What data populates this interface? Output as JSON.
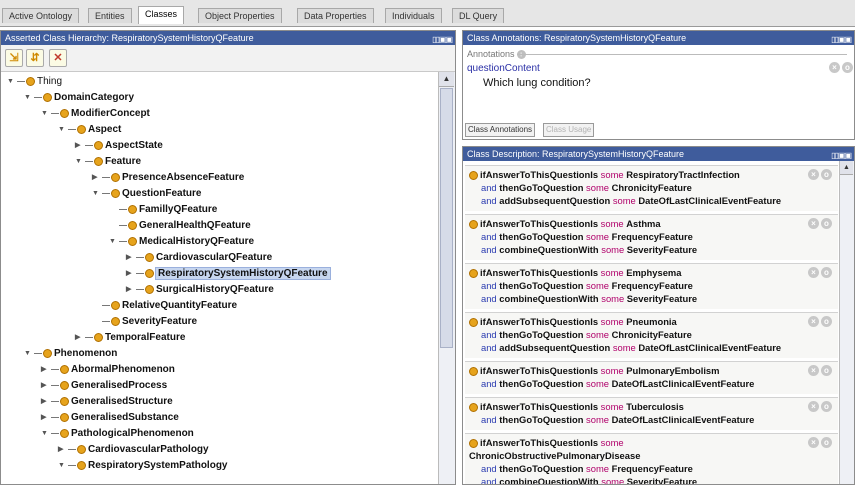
{
  "tabs": [
    "Active Ontology",
    "Entities",
    "Classes",
    "Object Properties",
    "Data Properties",
    "Individuals",
    "DL Query"
  ],
  "active_tab_index": 2,
  "left_panel": {
    "title": "Asserted Class Hierarchy: RespiratorySystemHistoryQFeature",
    "window_controls": "▯▯▣▣",
    "toolbar_icons": [
      "add-subclass-icon",
      "add-sibling-icon",
      "delete-class-icon"
    ],
    "tree": [
      {
        "label": "Thing",
        "state": "open"
      },
      {
        "label": "DomainCategory",
        "state": "open"
      },
      {
        "label": "ModifierConcept",
        "state": "open"
      },
      {
        "label": "Aspect",
        "state": "open"
      },
      {
        "label": "AspectState",
        "state": "closed"
      },
      {
        "label": "Feature",
        "state": "open"
      },
      {
        "label": "PresenceAbsenceFeature",
        "state": "closed"
      },
      {
        "label": "QuestionFeature",
        "state": "open"
      },
      {
        "label": "FamillyQFeature",
        "state": "leaf"
      },
      {
        "label": "GeneralHealthQFeature",
        "state": "leaf"
      },
      {
        "label": "MedicalHistoryQFeature",
        "state": "open"
      },
      {
        "label": "CardiovascularQFeature",
        "state": "closed"
      },
      {
        "label": "RespiratorySystemHistoryQFeature",
        "state": "closed",
        "selected": true
      },
      {
        "label": "SurgicalHistoryQFeature",
        "state": "closed"
      },
      {
        "label": "RelativeQuantityFeature",
        "state": "leaf"
      },
      {
        "label": "SeverityFeature",
        "state": "leaf"
      },
      {
        "label": "TemporalFeature",
        "state": "closed"
      },
      {
        "label": "Phenomenon",
        "state": "open"
      },
      {
        "label": "AbormalPhenomenon",
        "state": "closed"
      },
      {
        "label": "GeneralisedProcess",
        "state": "closed"
      },
      {
        "label": "GeneralisedStructure",
        "state": "closed"
      },
      {
        "label": "GeneralisedSubstance",
        "state": "closed"
      },
      {
        "label": "PathologicalPhenomenon",
        "state": "open"
      },
      {
        "label": "CardiovascularPathology",
        "state": "closed"
      },
      {
        "label": "RespiratorySystemPathology",
        "state": "open"
      }
    ]
  },
  "annotations_panel": {
    "title": "Class Annotations: RespiratorySystemHistoryQFeature",
    "window_controls": "▯▯▣▣",
    "header": "Annotations",
    "property": "questionContent",
    "value": "Which lung condition?",
    "tab_buttons": [
      "Class Annotations",
      "Class Usage"
    ]
  },
  "description_panel": {
    "title": "Class Description: RespiratorySystemHistoryQFeature",
    "window_controls": "▯▯▣▣",
    "axioms": [
      [
        [
          "ifAnswerToThisQuestionIs",
          " some ",
          "RespiratoryTractInfection"
        ],
        [
          "and",
          " thenGoToQuestion",
          " some ",
          "ChronicityFeature"
        ],
        [
          "and",
          " addSubsequentQuestion",
          " some ",
          "DateOfLastClinicalEventFeature"
        ]
      ],
      [
        [
          "ifAnswerToThisQuestionIs",
          " some ",
          "Asthma"
        ],
        [
          "and",
          " thenGoToQuestion",
          " some ",
          "FrequencyFeature"
        ],
        [
          "and",
          " combineQuestionWith",
          " some ",
          "SeverityFeature"
        ]
      ],
      [
        [
          "ifAnswerToThisQuestionIs",
          " some ",
          "Emphysema"
        ],
        [
          "and",
          " thenGoToQuestion",
          " some ",
          "FrequencyFeature"
        ],
        [
          "and",
          " combineQuestionWith",
          " some ",
          "SeverityFeature"
        ]
      ],
      [
        [
          "ifAnswerToThisQuestionIs",
          " some ",
          "Pneumonia"
        ],
        [
          "and",
          " thenGoToQuestion",
          " some ",
          "ChronicityFeature"
        ],
        [
          "and",
          " addSubsequentQuestion",
          " some ",
          "DateOfLastClinicalEventFeature"
        ]
      ],
      [
        [
          "ifAnswerToThisQuestionIs",
          " some ",
          "PulmonaryEmbolism"
        ],
        [
          "and",
          " thenGoToQuestion",
          " some ",
          "DateOfLastClinicalEventFeature"
        ]
      ],
      [
        [
          "ifAnswerToThisQuestionIs",
          " some ",
          "Tuberculosis"
        ],
        [
          "and",
          " thenGoToQuestion",
          " some ",
          "DateOfLastClinicalEventFeature"
        ]
      ],
      [
        [
          "ifAnswerToThisQuestionIs",
          " some ",
          ""
        ],
        [
          "",
          "",
          "",
          "ChronicObstructivePulmonaryDisease"
        ],
        [
          "and",
          " thenGoToQuestion",
          " some ",
          "FrequencyFeature"
        ],
        [
          "and",
          " combineQuestionWith",
          " some ",
          "SeverityFeature"
        ]
      ]
    ]
  }
}
